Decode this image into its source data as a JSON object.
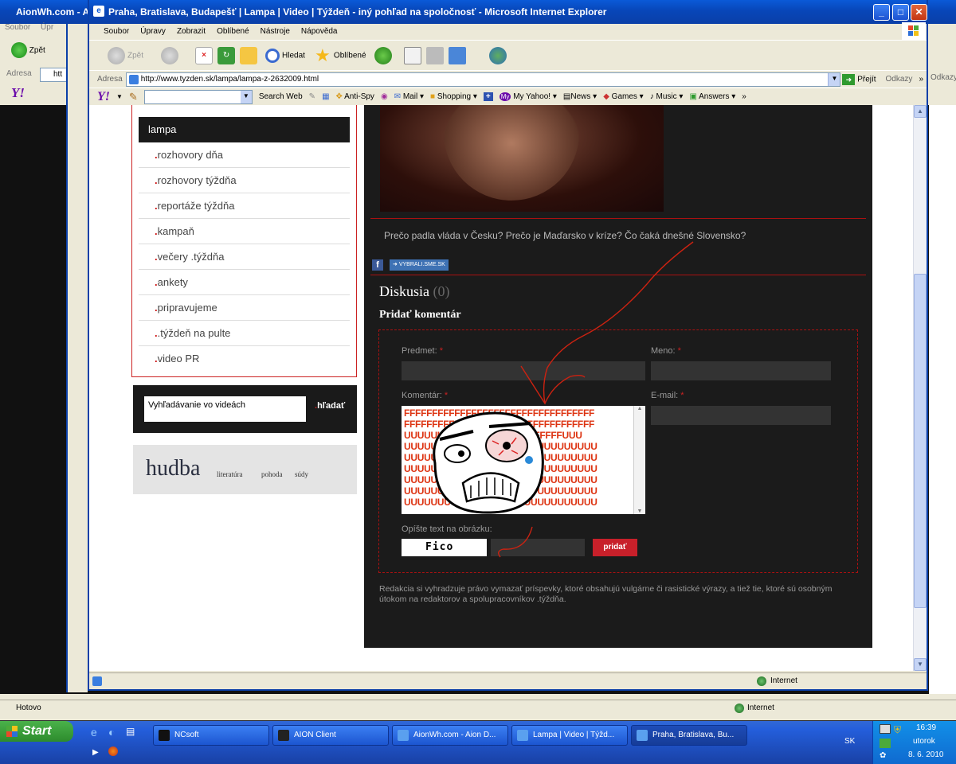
{
  "back_window": {
    "title": "AionWh.com - A",
    "menu": [
      "Soubor",
      "Úpr"
    ],
    "address_label": "Adresa",
    "address_value": "htt",
    "back_label": "Zpět",
    "status": "Hotovo",
    "zone": "Internet",
    "right_links": "Odkazy"
  },
  "ie": {
    "title": "Praha, Bratislava, Budapešť | Lampa | Video | Týždeň - iný pohľad na spoločnosť - Microsoft Internet Explorer",
    "menu": [
      "Soubor",
      "Úpravy",
      "Zobrazit",
      "Oblíbené",
      "Nástroje",
      "Nápověda"
    ],
    "toolbar": {
      "back": "Zpět",
      "search": "Hledat",
      "favorites": "Oblíbené"
    },
    "address_label": "Adresa",
    "url": "http://www.tyzden.sk/lampa/lampa-z-2632009.html",
    "go_label": "Přejít",
    "links_label": "Odkazy",
    "status_zone": "Internet"
  },
  "yahoo_toolbar": {
    "search_button": "Search Web",
    "items": [
      "Anti-Spy",
      "Mail",
      "Shopping",
      "My Yahoo!",
      "News",
      "Games",
      "Music",
      "Answers"
    ]
  },
  "sidebar": {
    "active_item": "lampa",
    "items": [
      "rozhovory dňa",
      "rozhovory týždňa",
      "reportáže týždňa",
      "kampaň",
      "večery .týždňa",
      "ankety",
      "pripravujeme",
      ".týždeň na pulte",
      "video PR"
    ],
    "search_placeholder": "Vyhľadávanie vo videách",
    "search_button": "hľadať",
    "tags": {
      "big": "hudba",
      "small": [
        "literatúra",
        "pohoda",
        "súdy"
      ]
    }
  },
  "article": {
    "caption": "Prečo padla vláda v Česku? Prečo je Maďarsko v kríze? Čo čaká dnešné Slovensko?",
    "share_badge": "VYBRALI.SME.SK",
    "discussion_title": "Diskusia",
    "discussion_count": "(0)",
    "add_comment": "Pridať komentár",
    "subject_label": "Predmet:",
    "name_label": "Meno:",
    "comment_label": "Komentár:",
    "email_label": "E-mail:",
    "captcha_label": "Opíšte text na obrázku:",
    "captcha_text": "Fico",
    "submit": "pridať",
    "disclaimer": "Redakcia si vyhradzuje právo vymazať príspevky, ktoré obsahujú vulgárne či rasistické výrazy, a tiež tie, ktoré sú osobným útokom na redaktorov a spolupracovníkov .týždňa.",
    "comment_rows": [
      "FFFFFFFFFFFFFFFFFFFFFFFFFFFFFFFFFF",
      "FFFFFFFFFFFFFFFFFFFFFFFFFFFFFFFFFF",
      "UUUUUUUUUUUUUUUUUFFFFFFFFUUU",
      "UUUUUUUUUUUUUUUUUUUUUUUUUUUUU",
      "UUUUUUUUUUUUUUUUUUUUUUUUUUUUU",
      "UUUUUUUUUUUUUUUUUUUUUUUUUUUUU",
      "UUUUUUUUUUUUUUUUUUUUUUUUUUUUU",
      "UUUUUUUUUUUUUUUUUUUUUUUUUUUUU",
      "UUUUUUUUUUUUUUUUUUUUUUUUUUUUU"
    ]
  },
  "taskbar": {
    "start": "Start",
    "buttons": [
      "NCsoft",
      "AION Client",
      "AionWh.com - Aion D...",
      "Lampa | Video | Týžd...",
      "Praha, Bratislava, Bu..."
    ],
    "lang": "SK",
    "time": "16:39",
    "day": "utorok",
    "date": "8. 6. 2010"
  }
}
